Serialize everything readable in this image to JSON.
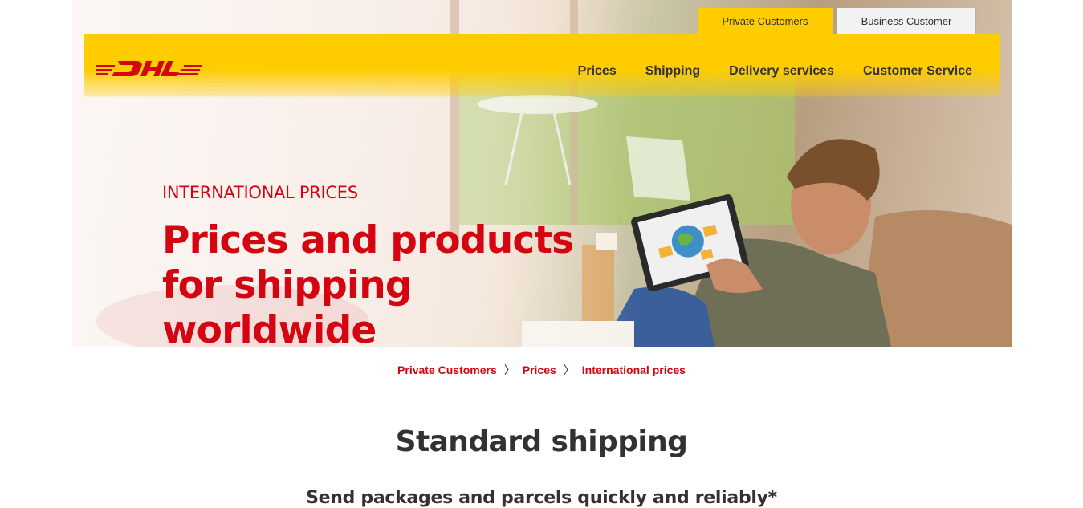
{
  "header": {
    "customer_tabs": [
      {
        "label": "Private Customers",
        "active": true
      },
      {
        "label": "Business Customer",
        "active": false
      }
    ],
    "logo": {
      "text": "DHL",
      "icon": "dhl-logo",
      "color": "#d40511"
    },
    "nav": [
      {
        "label": "Prices"
      },
      {
        "label": "Shipping"
      },
      {
        "label": "Delivery services"
      },
      {
        "label": "Customer Service"
      }
    ],
    "accent_color": "#ffcc00"
  },
  "hero": {
    "eyebrow": "INTERNATIONAL PRICES",
    "headline": "Prices and products for shipping worldwide",
    "text_color": "#d40511"
  },
  "breadcrumb": {
    "items": [
      "Private Customers",
      "Prices",
      "International prices"
    ],
    "separator": "〉"
  },
  "section": {
    "title": "Standard shipping",
    "subtitle": "Send packages and parcels quickly and reliably*"
  }
}
